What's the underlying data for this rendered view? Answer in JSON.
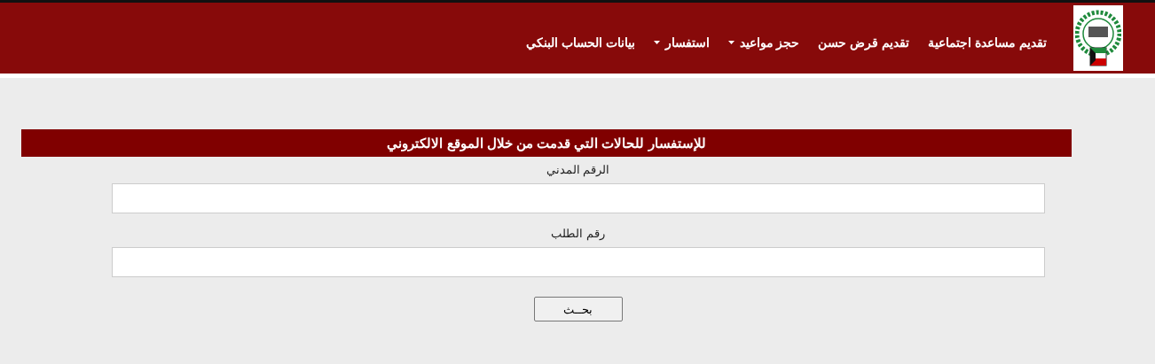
{
  "header": {
    "nav": [
      {
        "label": "تقديم مساعدة اجتماعية",
        "dropdown": false
      },
      {
        "label": "تقديم قرض حسن",
        "dropdown": false
      },
      {
        "label": "حجز مواعيد",
        "dropdown": true
      },
      {
        "label": "استفسار",
        "dropdown": true
      },
      {
        "label": "بيانات الحساب البنكي",
        "dropdown": false
      }
    ]
  },
  "form": {
    "title": "للإستفسار للحالات التي قدمت من خلال الموقع الالكتروني",
    "fields": [
      {
        "label": "الرقم المدني"
      },
      {
        "label": "رقم الطلب"
      }
    ],
    "button": "بحــث"
  }
}
